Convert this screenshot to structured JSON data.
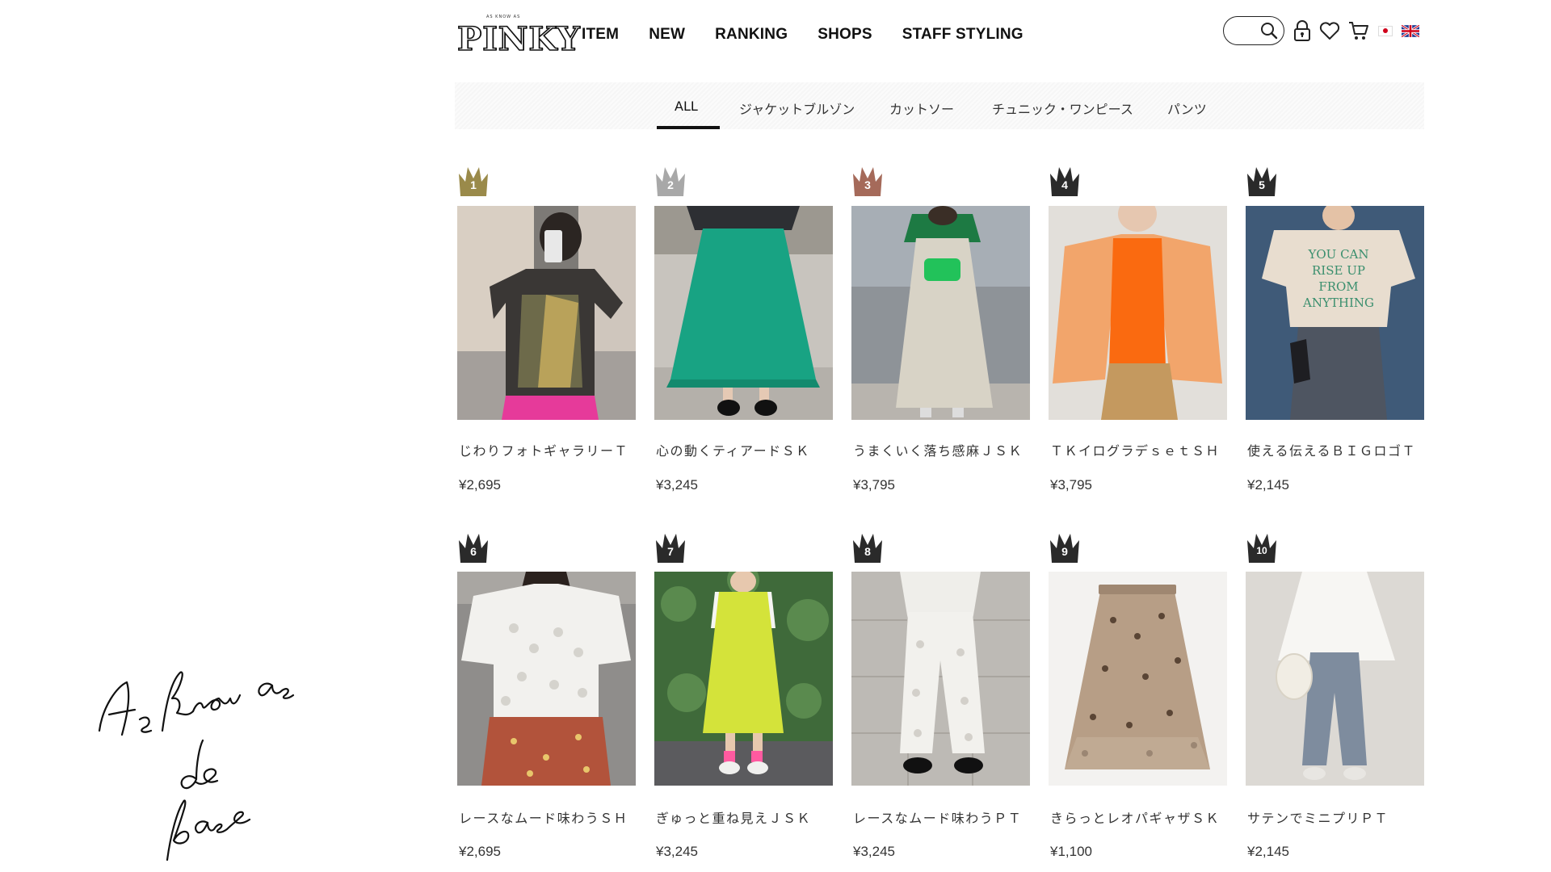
{
  "header": {
    "logo_small": "AS KNOW AS",
    "logo_main": "PINKY",
    "nav": [
      "ITEM",
      "NEW",
      "RANKING",
      "SHOPS",
      "STAFF STYLING"
    ],
    "icons": [
      "search-icon",
      "lock-icon",
      "heart-icon",
      "cart-icon",
      "flag-jp-icon",
      "flag-uk-icon"
    ]
  },
  "tabs": [
    "ALL",
    "ジャケットブルゾン",
    "カットソー",
    "チュニック・ワンピース",
    "パンツ"
  ],
  "active_tab": "ALL",
  "crown_colors": {
    "gold": "#9a8a4a",
    "silver": "#a8a8a8",
    "bronze": "#a56a5a",
    "black": "#2a2a2a"
  },
  "products": [
    {
      "rank": "1",
      "name": "じわりフォトギャラリーＴ",
      "price": "¥2,695",
      "crown": "gold"
    },
    {
      "rank": "2",
      "name": "心の動くティアードＳＫ",
      "price": "¥3,245",
      "crown": "silver"
    },
    {
      "rank": "3",
      "name": "うまくいく落ち感麻ＪＳＫ",
      "price": "¥3,795",
      "crown": "bronze"
    },
    {
      "rank": "4",
      "name": "ＴＫイログラデｓｅｔＳＨ",
      "price": "¥3,795",
      "crown": "black"
    },
    {
      "rank": "5",
      "name": "使える伝えるＢＩＧロゴＴ",
      "price": "¥2,145",
      "crown": "black"
    },
    {
      "rank": "6",
      "name": "レースなムード味わうＳＨ",
      "price": "¥2,695",
      "crown": "black"
    },
    {
      "rank": "7",
      "name": "ぎゅっと重ね見えＪＳＫ",
      "price": "¥3,245",
      "crown": "black"
    },
    {
      "rank": "8",
      "name": "レースなムード味わうＰＴ",
      "price": "¥3,245",
      "crown": "black"
    },
    {
      "rank": "9",
      "name": "きらっとレオパギャザＳＫ",
      "price": "¥1,100",
      "crown": "black"
    },
    {
      "rank": "10",
      "name": "サテンでミニプリＰＴ",
      "price": "¥2,145",
      "crown": "black"
    }
  ],
  "tshirt_print": [
    "YOU CAN",
    "RISE UP",
    "FROM",
    "ANYTHING"
  ],
  "signature_text": "As know as de base"
}
